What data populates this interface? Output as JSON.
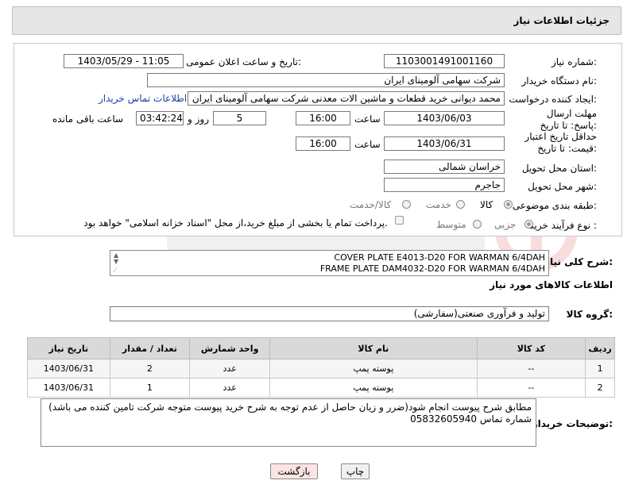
{
  "header": {
    "title": "جزئیات اطلاعات نیاز"
  },
  "form": {
    "need_number": {
      "label": "شماره نیاز:",
      "value": "1103001491001160"
    },
    "announce_datetime": {
      "label": "تاریخ و ساعت اعلان عمومی:",
      "value": "1403/05/29 - 11:05"
    },
    "buyer_org": {
      "label": "نام دستگاه خریدار:",
      "value": "شرکت سهامی آلومینای ایران"
    },
    "requester": {
      "label": "ایجاد کننده درخواست:",
      "value": "محمد دیوانی خرید قطعات و ماشین الات معدنی شرکت سهامی آلومینای ایران",
      "link": "اطلاعات تماس خریدار"
    },
    "reply_deadline": {
      "label": "مهلت ارسال پاسخ: تا تاریخ:",
      "date": "1403/06/03",
      "time_label": "ساعت",
      "time": "16:00",
      "days": "5",
      "days_label": "روز و",
      "remaining": "03:42:24",
      "remaining_label": "ساعت باقی مانده"
    },
    "price_validity": {
      "label": "حداقل تاریخ اعتبار قیمت: تا تاریخ:",
      "date": "1403/06/31",
      "time_label": "ساعت",
      "time": "16:00"
    },
    "delivery_province": {
      "label": "استان محل تحویل:",
      "value": "خراسان شمالی"
    },
    "delivery_city": {
      "label": "شهر محل تحویل:",
      "value": "جاجرم"
    },
    "category": {
      "label": "طبقه بندی موضوعی:",
      "options": [
        "کالا",
        "خدمت",
        "کالا/خدمت"
      ]
    },
    "process": {
      "label": "نوع فرآیند خرید :",
      "options": [
        "جزیی",
        "متوسط"
      ],
      "payment_note": "پرداخت تمام یا بخشی از مبلغ خرید،از محل \"اسناد خزانه اسلامی\" خواهد بود."
    }
  },
  "description": {
    "label": "شرح کلی نیاز:",
    "lines": [
      "COVER PLATE E4013-D20 FOR WARMAN 6/4DAH",
      "FRAME PLATE DAM4032-D20 FOR WARMAN 6/4DAH"
    ]
  },
  "goods_section": {
    "title": "اطلاعات کالاهای مورد نیاز",
    "group_label": "گروه کالا:",
    "group_value": "تولید و فرآوری صنعتی(سفارشی)"
  },
  "table": {
    "headers": [
      "ردیف",
      "کد کالا",
      "نام کالا",
      "واحد شمارش",
      "تعداد / مقدار",
      "تاریخ نیاز"
    ],
    "rows": [
      [
        "1",
        "--",
        "پوسته پمپ",
        "عدد",
        "2",
        "1403/06/31"
      ],
      [
        "2",
        "--",
        "پوسته پمپ",
        "عدد",
        "1",
        "1403/06/31"
      ]
    ]
  },
  "buyer_notes": {
    "label": "توضیحات خریدار:",
    "text": "مطابق شرح پیوست انجام شود(ضرر و زیان حاصل از عدم توجه به شرح خرید پیوست متوجه شرکت تامین کننده می باشد) شماره تماس 05832605940"
  },
  "buttons": {
    "print": "چاپ",
    "back": "بازگشت"
  },
  "colors": {
    "link": "#1a3fa8",
    "header_bg": "#e6e6e6",
    "back_btn_bg": "#fde4e4"
  }
}
